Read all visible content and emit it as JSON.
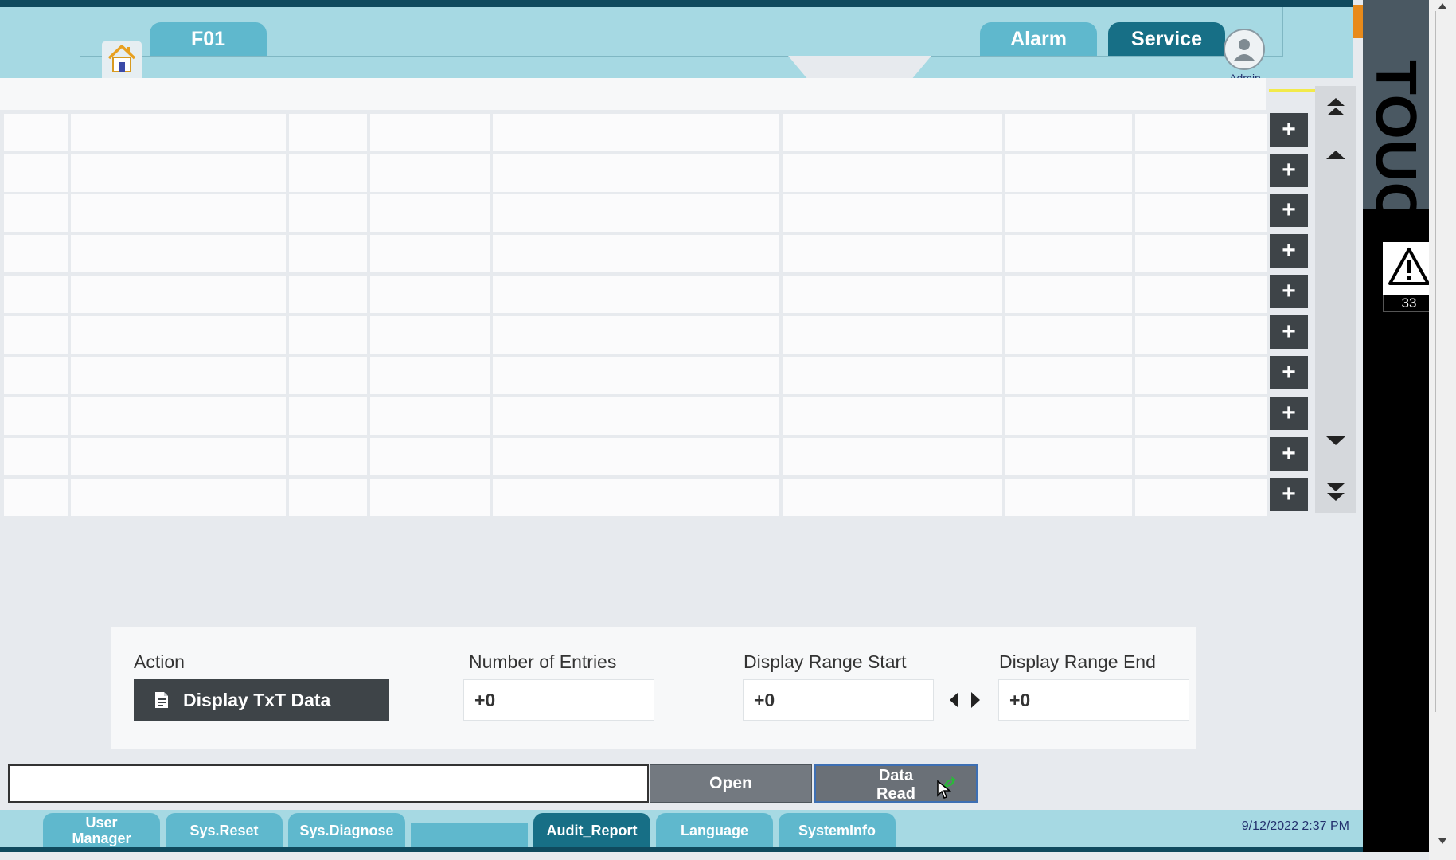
{
  "header": {
    "panel_tab": "F01",
    "alarm_tab": "Alarm",
    "service_tab": "Service",
    "user_label": "Admin",
    "side_brand": "TOUCH",
    "alarm_count": "33"
  },
  "table": {
    "rows": 10,
    "row_button_label": "+"
  },
  "action_panel": {
    "action_label": "Action",
    "display_button": "Display TxT Data",
    "entries_label": "Number of Entries",
    "entries_value": "+0",
    "range_start_label": "Display Range Start",
    "range_start_value": "+0",
    "range_end_label": "Display Range End",
    "range_end_value": "+0"
  },
  "file_row": {
    "filename_value": "",
    "open_button": "Open",
    "data_read_line1": "Data",
    "data_read_line2": "Read"
  },
  "bottom_nav": {
    "tabs": [
      {
        "label_line1": "User",
        "label_line2": "Manager"
      },
      {
        "label": "Sys.Reset"
      },
      {
        "label": "Sys.Diagnose"
      },
      {
        "label": ""
      },
      {
        "label": "Audit_Report"
      },
      {
        "label": "Language"
      },
      {
        "label": "SystemInfo"
      }
    ],
    "datetime": "9/12/2022 2:37 PM"
  },
  "colors": {
    "header_band": "#a6d9e3",
    "tab_light": "#5fb8cd",
    "tab_active": "#176f86",
    "dark_button": "#3e4448",
    "page_bg": "#e7eaee"
  }
}
